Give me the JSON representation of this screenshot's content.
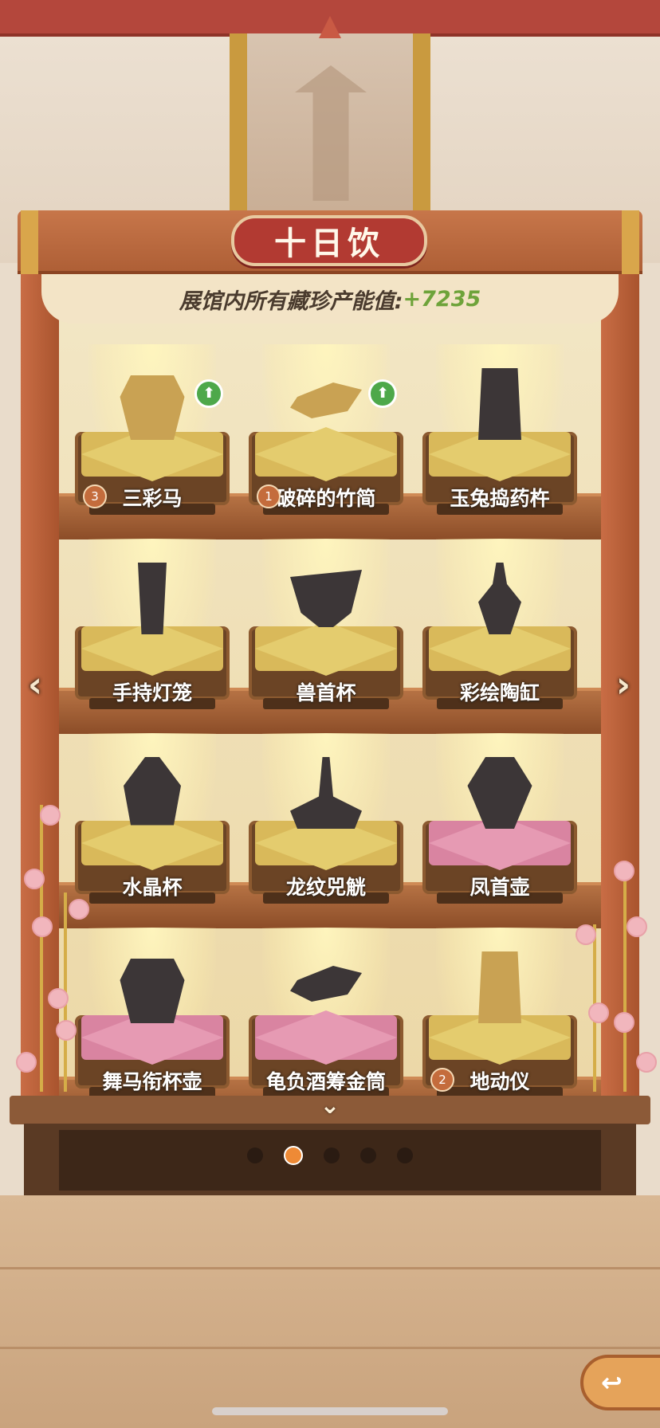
{
  "header": {
    "title": "十日饮",
    "value_label": "展馆内所有藏珍产能值:",
    "value": "+7235"
  },
  "colors": {
    "title_red": "#b23a32",
    "value_green": "#6ea33a",
    "active_dot": "#ee8a36"
  },
  "shelves": [
    [
      {
        "name": "三彩马",
        "level": "3",
        "upgrade": true,
        "revealed": true,
        "cushion": "gold"
      },
      {
        "name": "破碎的竹简",
        "level": "1",
        "upgrade": true,
        "revealed": true,
        "cushion": "gold"
      },
      {
        "name": "玉兔捣药杵",
        "level": "",
        "upgrade": false,
        "revealed": false,
        "cushion": "gold"
      }
    ],
    [
      {
        "name": "手持灯笼",
        "level": "",
        "upgrade": false,
        "revealed": false,
        "cushion": "gold"
      },
      {
        "name": "兽首杯",
        "level": "",
        "upgrade": false,
        "revealed": false,
        "cushion": "gold"
      },
      {
        "name": "彩绘陶缸",
        "level": "",
        "upgrade": false,
        "revealed": false,
        "cushion": "gold"
      }
    ],
    [
      {
        "name": "水晶杯",
        "level": "",
        "upgrade": false,
        "revealed": false,
        "cushion": "gold"
      },
      {
        "name": "龙纹兕觥",
        "level": "",
        "upgrade": false,
        "revealed": false,
        "cushion": "gold"
      },
      {
        "name": "凤首壶",
        "level": "",
        "upgrade": false,
        "revealed": false,
        "cushion": "pink"
      }
    ],
    [
      {
        "name": "舞马衔杯壶",
        "level": "",
        "upgrade": false,
        "revealed": false,
        "cushion": "pink"
      },
      {
        "name": "龟负酒筹金筒",
        "level": "",
        "upgrade": false,
        "revealed": false,
        "cushion": "pink"
      },
      {
        "name": "地动仪",
        "level": "2",
        "upgrade": false,
        "revealed": true,
        "cushion": "gold"
      }
    ]
  ],
  "icons": {
    "prev": "chevron-left-icon",
    "next": "chevron-right-icon",
    "down": "chevron-down-icon",
    "upgrade": "arrow-up-icon",
    "back": "return-icon"
  },
  "pagination": {
    "count": 5,
    "active": 1
  },
  "glyphs": {
    "prev": "‹",
    "next": "›",
    "down": "⌄",
    "up": "⬆",
    "back": "↩"
  }
}
